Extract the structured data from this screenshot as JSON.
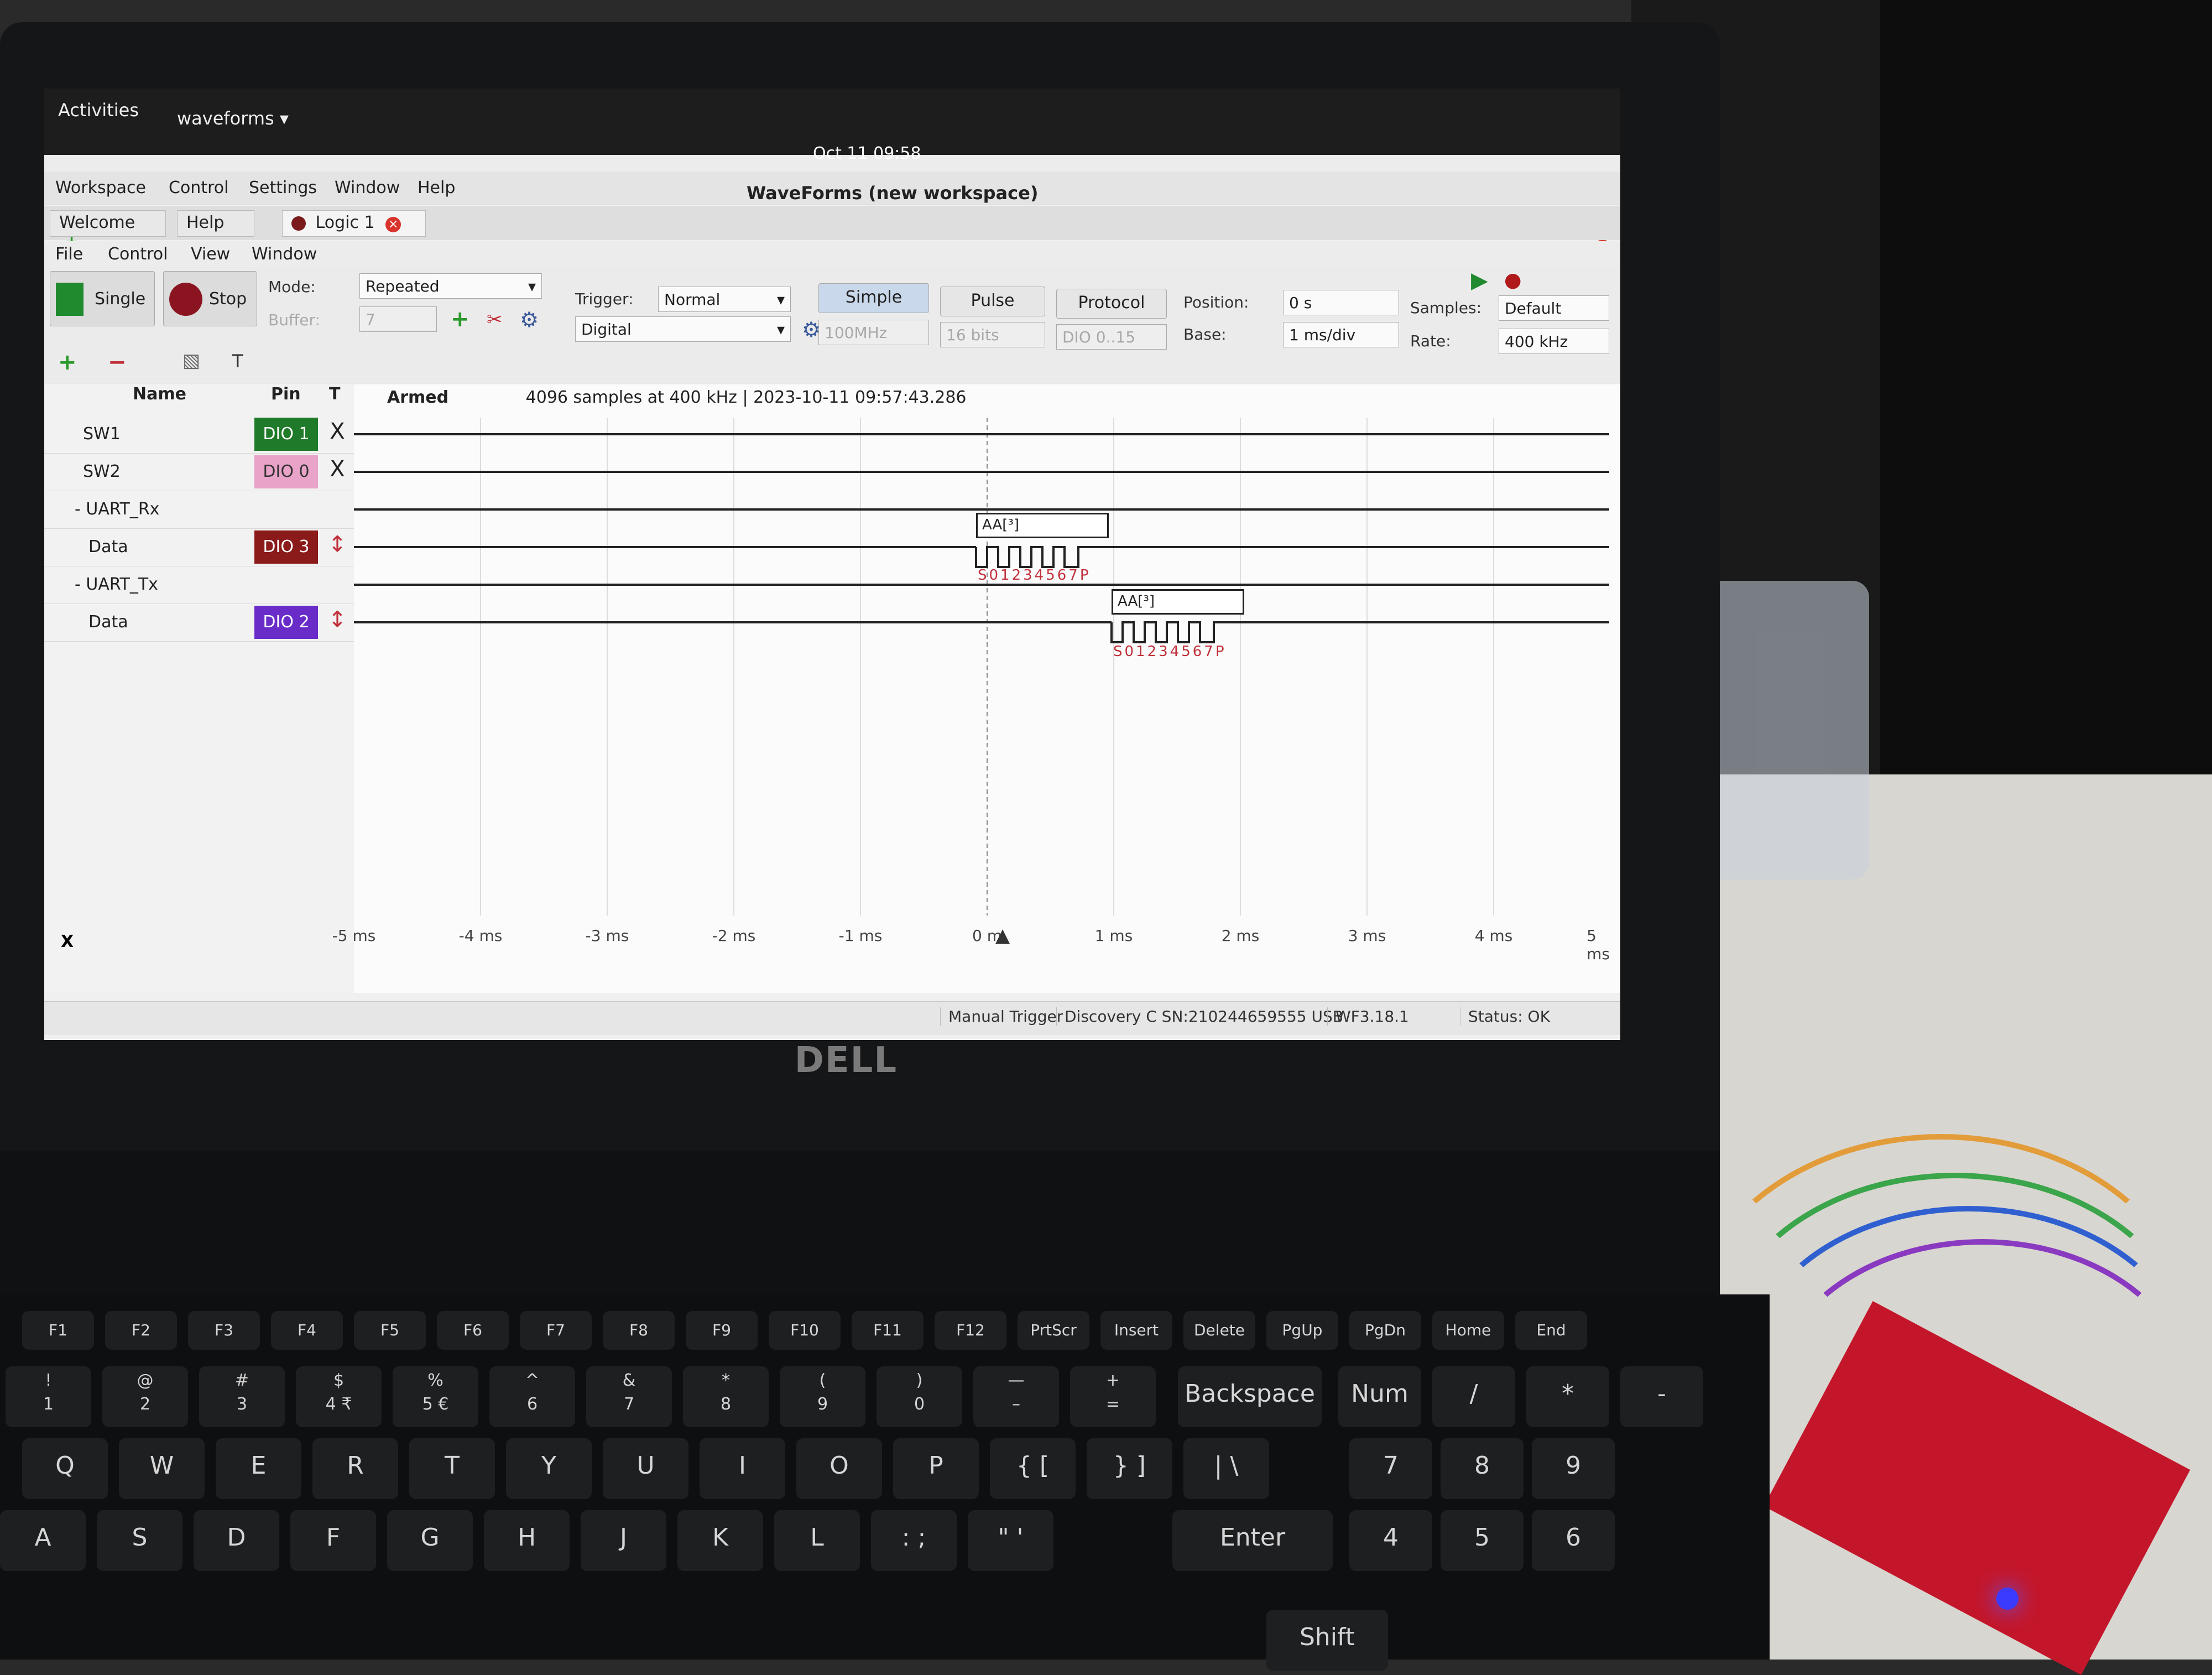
{
  "topbar": {
    "activities": "Activities",
    "app": "waveforms ▾",
    "clock": "Oct 11  09:58"
  },
  "window": {
    "title": "WaveForms (new workspace)",
    "menus": [
      "Workspace",
      "Control",
      "Settings",
      "Window",
      "Help"
    ],
    "tabs": [
      "Welcome",
      "Help",
      "Logic 1"
    ],
    "submenus": [
      "File",
      "Control",
      "View",
      "Window"
    ]
  },
  "toolbar": {
    "single": "Single",
    "stop": "Stop",
    "mode_label": "Mode:",
    "mode_value": "Repeated",
    "buffer_label": "Buffer:",
    "buffer_value": "7",
    "trigger_label": "Trigger:",
    "trigger_value": "Normal",
    "source_value": "Digital",
    "simple": "Simple",
    "pulse": "Pulse",
    "protocol": "Protocol",
    "freq_value": "100MHz",
    "bits_value": "16 bits",
    "dio_value": "DIO 0..15",
    "position_label": "Position:",
    "position_value": "0 s",
    "base_label": "Base:",
    "base_value": "1 ms/div",
    "samples_label": "Samples:",
    "samples_value": "Default",
    "rate_label": "Rate:",
    "rate_value": "400 kHz"
  },
  "channels": {
    "headers": {
      "name": "Name",
      "pin": "Pin",
      "t": "T"
    },
    "rows": [
      {
        "name": "SW1",
        "pin": "DIO 1",
        "trigger": "X",
        "color": "#1f7a2a"
      },
      {
        "name": "SW2",
        "pin": "DIO 0",
        "trigger": "X",
        "color": "#e9a3c9"
      },
      {
        "name": "- UART_Rx",
        "pin": "",
        "trigger": "",
        "color": ""
      },
      {
        "name": "Data",
        "pin": "DIO 3",
        "trigger": "↕",
        "color": "#8b1a1a"
      },
      {
        "name": "- UART_Tx",
        "pin": "",
        "trigger": "",
        "color": ""
      },
      {
        "name": "Data",
        "pin": "DIO 2",
        "trigger": "↕",
        "color": "#6a2cc9"
      }
    ]
  },
  "plot": {
    "armed": "Armed",
    "info": "4096 samples at 400 kHz | 2023-10-11 09:57:43.286",
    "rx_decode": "AA[³]",
    "tx_decode": "AA[³]",
    "rx_bits": "S01234567P",
    "tx_bits": "S01234567P",
    "axis": [
      "-5 ms",
      "-4 ms",
      "-3 ms",
      "-2 ms",
      "-1 ms",
      "0 m",
      "1 ms",
      "2 ms",
      "3 ms",
      "4 ms",
      "5 ms"
    ]
  },
  "status": {
    "x_label": "X",
    "trigger_mode": "Manual Trigger",
    "device": "Discovery C SN:210244659555 USB",
    "version": "WF3.18.1",
    "status": "Status: OK"
  },
  "laptop": {
    "brand": "DELL"
  },
  "keys": {
    "fn": [
      "F1",
      "F2",
      "F3",
      "F4",
      "F5",
      "F6",
      "F7",
      "F8",
      "F9",
      "F10",
      "F11",
      "F12",
      "PrtScr",
      "Insert",
      "Delete",
      "PgUp",
      "PgDn",
      "Home",
      "End"
    ],
    "num": [
      [
        "!",
        "1"
      ],
      [
        "@",
        "2"
      ],
      [
        "#",
        "3"
      ],
      [
        "$",
        "4 ₹"
      ],
      [
        "%",
        "5 €"
      ],
      [
        "^",
        "6"
      ],
      [
        "&",
        "7"
      ],
      [
        "*",
        "8"
      ],
      [
        "(",
        "9"
      ],
      [
        ")",
        "0"
      ],
      [
        "—",
        "–"
      ],
      [
        "+",
        "="
      ]
    ],
    "backspace": "Backspace",
    "numlock": "Num Lock",
    "pad1": [
      "/",
      "*",
      "-"
    ],
    "qrow": [
      "Q",
      "W",
      "E",
      "R",
      "T",
      "Y",
      "U",
      "I",
      "O",
      "P",
      "{ [",
      "} ]",
      "| \\"
    ],
    "pad2": [
      "7",
      "8",
      "9"
    ],
    "arow": [
      "A",
      "S",
      "D",
      "F",
      "G",
      "H",
      "J",
      "K",
      "L",
      ": ;",
      "\" '"
    ],
    "enter": "Enter",
    "pad3": [
      "4",
      "5",
      "6"
    ],
    "shift": "Shift"
  }
}
